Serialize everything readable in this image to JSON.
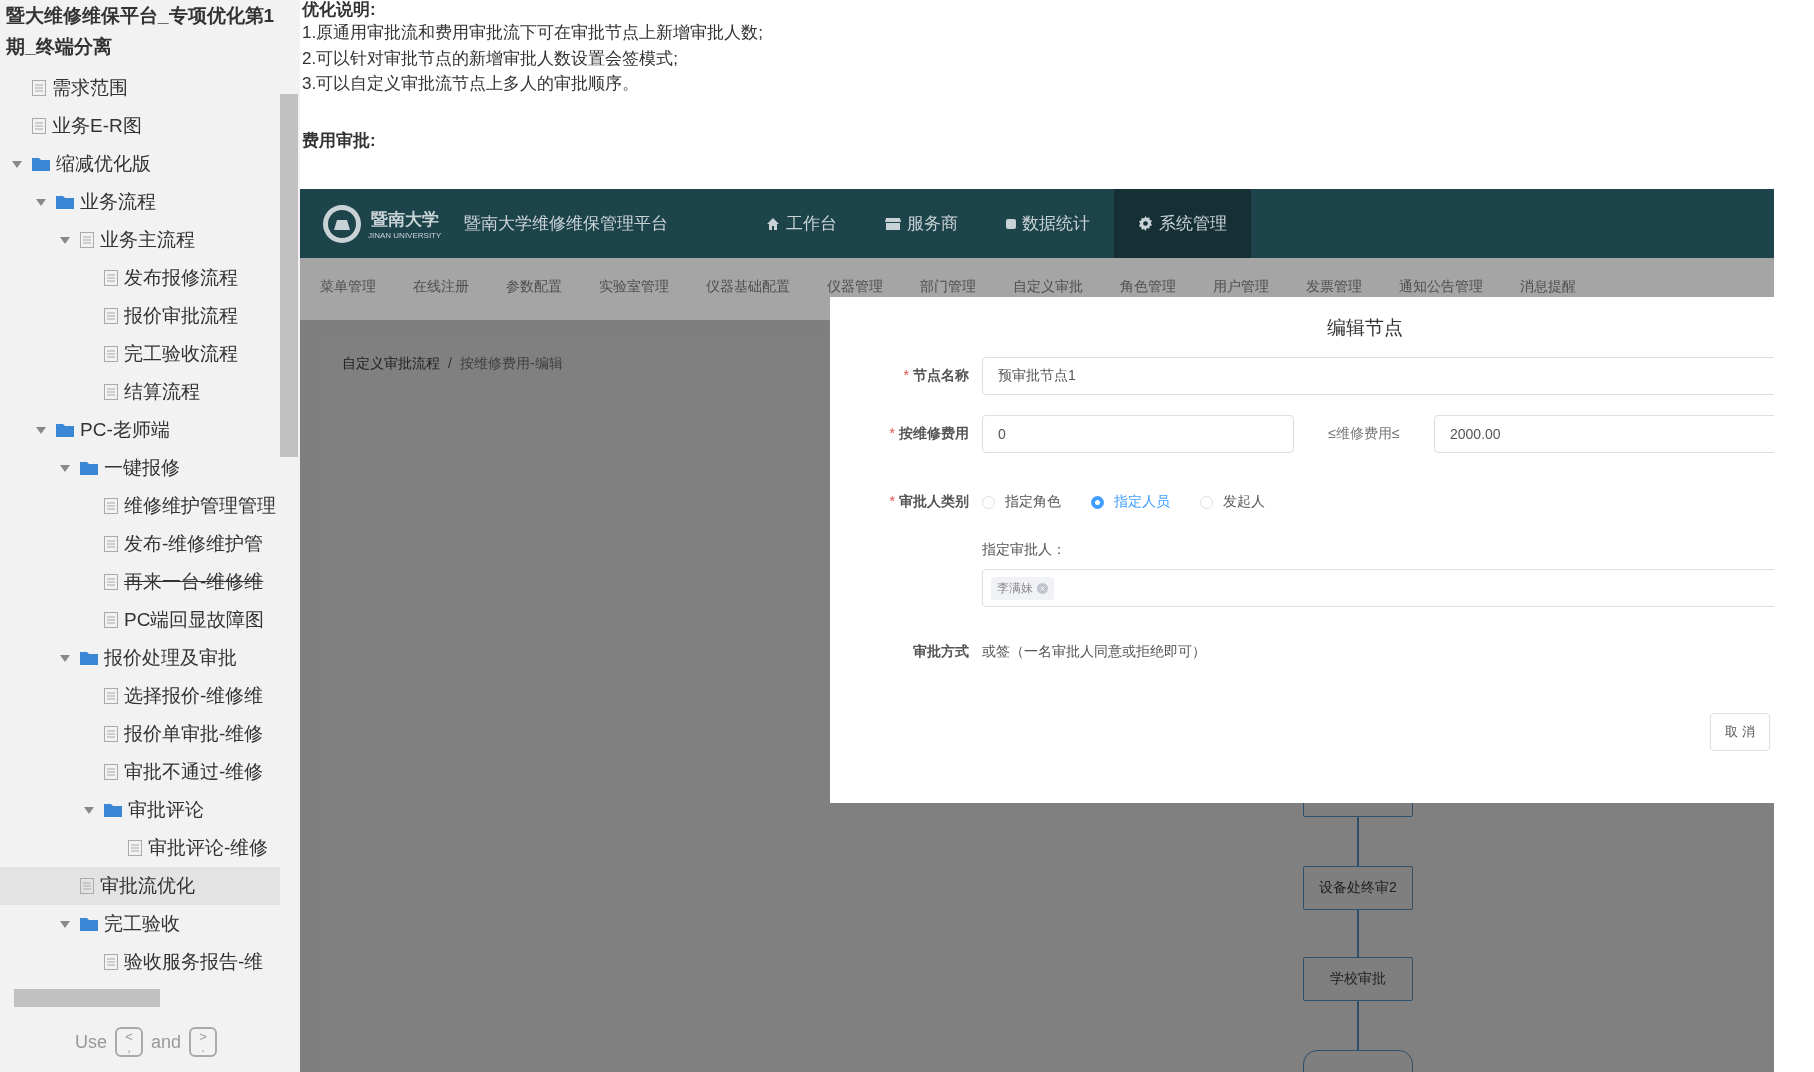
{
  "sidebar": {
    "title": "暨大维修维保平台_专项优化第1期_终端分离",
    "tree": [
      {
        "label": "需求范围",
        "kind": "page",
        "selected": false,
        "struck": false
      },
      {
        "label": "业务E-R图",
        "kind": "page",
        "selected": false,
        "struck": false
      },
      {
        "label": "缩减优化版",
        "kind": "folder",
        "selected": false,
        "struck": false,
        "expanded": true,
        "children": [
          {
            "label": "业务流程",
            "kind": "folder",
            "selected": false,
            "struck": false,
            "expanded": true,
            "children": [
              {
                "label": "业务主流程",
                "kind": "page",
                "selected": false,
                "struck": false,
                "expanded": true,
                "children": [
                  {
                    "label": "发布报修流程",
                    "kind": "page",
                    "selected": false,
                    "struck": false
                  },
                  {
                    "label": "报价审批流程",
                    "kind": "page",
                    "selected": false,
                    "struck": false
                  },
                  {
                    "label": "完工验收流程",
                    "kind": "page",
                    "selected": false,
                    "struck": false
                  },
                  {
                    "label": "结算流程",
                    "kind": "page",
                    "selected": false,
                    "struck": false
                  }
                ]
              }
            ]
          },
          {
            "label": "PC-老师端",
            "kind": "folder",
            "selected": false,
            "struck": false,
            "expanded": true,
            "children": [
              {
                "label": "一键报修",
                "kind": "folder",
                "selected": false,
                "struck": false,
                "expanded": true,
                "children": [
                  {
                    "label": "维修维护管理管理",
                    "kind": "page",
                    "selected": false,
                    "struck": false
                  },
                  {
                    "label": "发布-维修维护管",
                    "kind": "page",
                    "selected": false,
                    "struck": false
                  },
                  {
                    "label": "再来一台-维修维",
                    "kind": "page",
                    "selected": false,
                    "struck": true
                  },
                  {
                    "label": "PC端回显故障图",
                    "kind": "page",
                    "selected": false,
                    "struck": false
                  }
                ]
              },
              {
                "label": "报价处理及审批",
                "kind": "folder",
                "selected": false,
                "struck": false,
                "expanded": true,
                "children": [
                  {
                    "label": "选择报价-维修维",
                    "kind": "page",
                    "selected": false,
                    "struck": false
                  },
                  {
                    "label": "报价单审批-维修",
                    "kind": "page",
                    "selected": false,
                    "struck": false
                  },
                  {
                    "label": "审批不通过-维修",
                    "kind": "page",
                    "selected": false,
                    "struck": false
                  },
                  {
                    "label": "审批评论",
                    "kind": "folder",
                    "selected": false,
                    "struck": false,
                    "expanded": true,
                    "children": [
                      {
                        "label": "审批评论-维修",
                        "kind": "page",
                        "selected": false,
                        "struck": false
                      }
                    ]
                  }
                ]
              },
              {
                "label": "审批流优化",
                "kind": "page",
                "selected": true,
                "struck": false
              },
              {
                "label": "完工验收",
                "kind": "folder",
                "selected": false,
                "struck": false,
                "expanded": true,
                "children": [
                  {
                    "label": "验收服务报告-维",
                    "kind": "page",
                    "selected": false,
                    "struck": false
                  }
                ]
              }
            ]
          }
        ]
      }
    ],
    "hint": {
      "use": "Use",
      "prev_key": [
        "<",
        ","
      ],
      "and": "and",
      "next_key": [
        ">",
        "."
      ]
    }
  },
  "doc": {
    "heading": "优化说明:",
    "lines": [
      "1.原通用审批流和费用审批流下可在审批节点上新增审批人数;",
      "2.可以针对审批节点的新增审批人数设置会签模式;",
      "3.可以自定义审批流节点上多人的审批顺序。"
    ],
    "section": "费用审批:"
  },
  "app": {
    "logo_text": "暨南大学",
    "logo_subtext": "JINAN UNIVERSITY",
    "platform": "暨南大学维修维保管理平台",
    "nav": [
      {
        "label": "工作台",
        "selected": false
      },
      {
        "label": "服务商",
        "selected": false
      },
      {
        "label": "数据统计",
        "selected": false
      },
      {
        "label": "系统管理",
        "selected": true
      }
    ],
    "menu": [
      "菜单管理",
      "在线注册",
      "参数配置",
      "实验室管理",
      "仪器基础配置",
      "仪器管理",
      "部门管理",
      "自定义审批",
      "角色管理",
      "用户管理",
      "发票管理",
      "通知公告管理",
      "消息提醒"
    ],
    "breadcrumb": [
      "自定义审批流程",
      "按维修费用-编辑"
    ],
    "breadcrumb_separator": "/",
    "flow_nodes": [
      {
        "kind": "box"
      },
      {
        "kind": "box",
        "label": "设备处终审2"
      },
      {
        "kind": "box",
        "label": "学校审批"
      },
      {
        "kind": "end"
      }
    ]
  },
  "dialog": {
    "title": "编辑节点",
    "required_mark": "*",
    "form": [
      {
        "kind": "text",
        "label": "节点名称",
        "required": true,
        "value": "预审批节点1"
      },
      {
        "kind": "range",
        "label": "按维修费用",
        "required": true,
        "from": "0",
        "between": "≤维修费用≤",
        "to": "2000.00"
      },
      {
        "kind": "radio",
        "label": "审批人类别",
        "required": true,
        "options": [
          {
            "label": "指定角色",
            "selected": false
          },
          {
            "label": "指定人员",
            "selected": true
          },
          {
            "label": "发起人",
            "selected": false
          }
        ]
      },
      {
        "kind": "approvers",
        "caption": "指定审批人：",
        "tags": [
          "李满妹"
        ]
      },
      {
        "kind": "static",
        "label": "审批方式",
        "required": false,
        "value": "或签（一名审批人同意或拒绝即可）"
      }
    ],
    "cancel": "取 消"
  }
}
